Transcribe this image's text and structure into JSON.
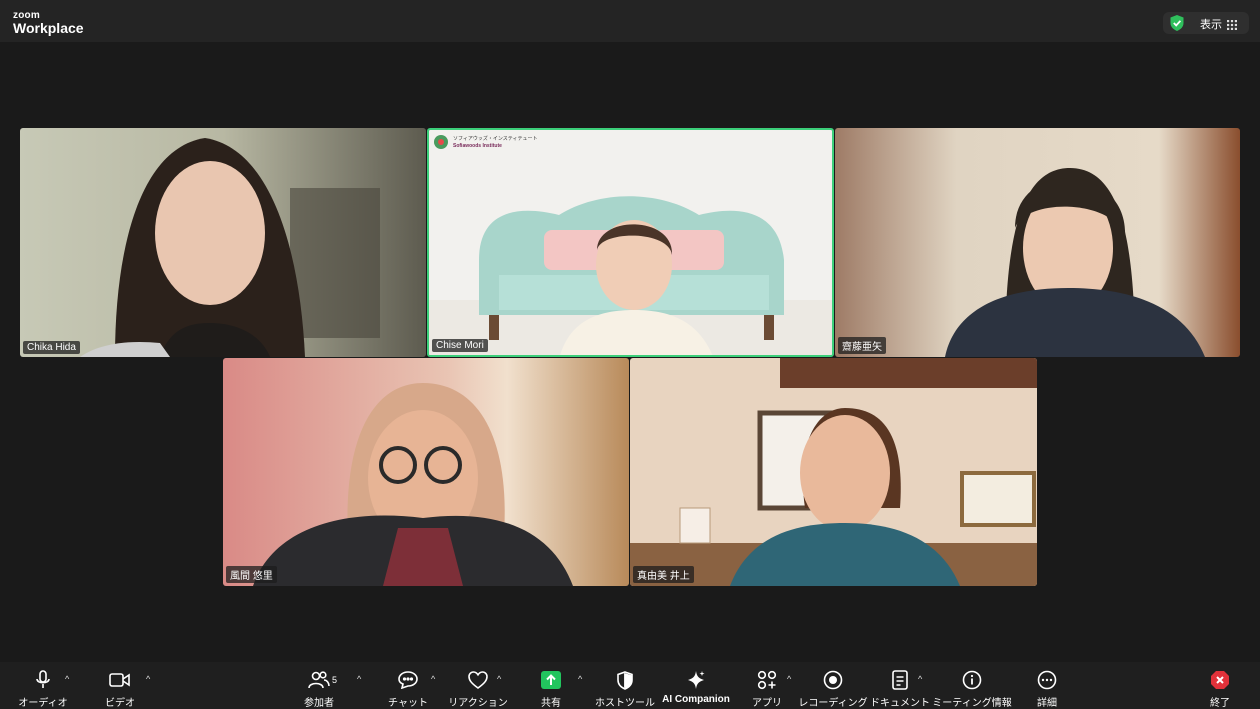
{
  "app": {
    "logo_small": "zoom",
    "logo_large": "Workplace"
  },
  "header": {
    "view_label": "表示",
    "shield_icon": "shield-check-icon",
    "grid_icon": "grid-icon",
    "accent": "#2fbf5c"
  },
  "participants": [
    {
      "name": "Chika Hida",
      "active": false
    },
    {
      "name": "Chise Mori",
      "active": true,
      "bg_logo_jp": "ソフィアウッズ・インスティテュート",
      "bg_logo_en": "Sofiawoods Institute"
    },
    {
      "name": "齋藤亜矢",
      "active": false
    },
    {
      "name": "風間 悠里",
      "active": false
    },
    {
      "name": "真由美 井上",
      "active": false
    }
  ],
  "toolbar": {
    "audio": "オーディオ",
    "video": "ビデオ",
    "participants": "参加者",
    "participants_count": "5",
    "chat": "チャット",
    "reactions": "リアクション",
    "share": "共有",
    "host_tools": "ホストツール",
    "ai_companion": "AI Companion",
    "apps": "アプリ",
    "recording": "レコーディング",
    "docs": "ドキュメント",
    "meeting_info": "ミーティング情報",
    "more": "詳細",
    "end": "終了",
    "share_color": "#22c55e",
    "end_color": "#e0313a"
  }
}
